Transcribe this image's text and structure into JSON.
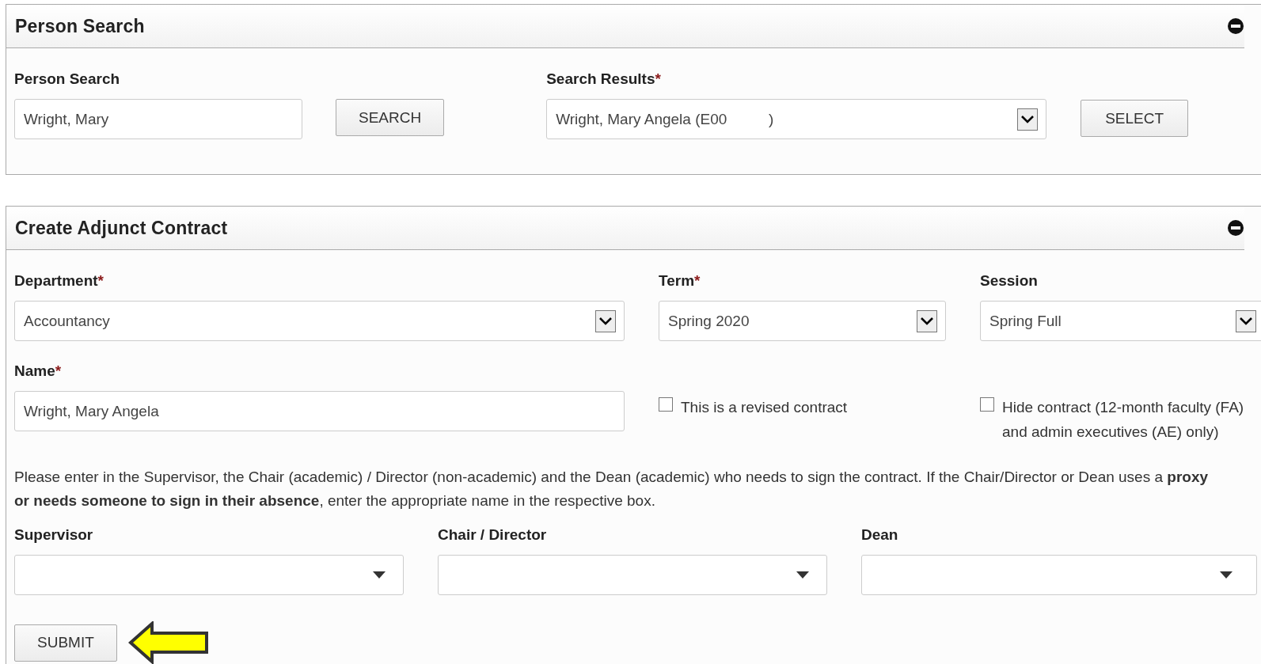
{
  "person_search": {
    "title": "Person Search",
    "expanded": true,
    "search_field": {
      "label": "Person Search",
      "value": "Wright, Mary"
    },
    "search_button": "SEARCH",
    "results": {
      "label": "Search Results",
      "required_mark": "*",
      "value": "Wright, Mary Angela (E00          )"
    },
    "select_button": "SELECT"
  },
  "create_contract": {
    "title": "Create Adjunct Contract",
    "expanded": true,
    "department": {
      "label": "Department",
      "required_mark": "*",
      "value": "Accountancy"
    },
    "term": {
      "label": "Term",
      "required_mark": "*",
      "value": "Spring 2020"
    },
    "session": {
      "label": "Session",
      "value": "Spring Full"
    },
    "name": {
      "label": "Name",
      "required_mark": "*",
      "value": "Wright, Mary Angela"
    },
    "checkboxes": [
      {
        "label": "This is a revised contract",
        "checked": false
      },
      {
        "label": "Hide contract (12-month faculty (FA) and admin executives (AE) only)",
        "checked": false
      }
    ],
    "instructions": "Please enter in the Supervisor, the Chair (academic) / Director (non-academic) and the Dean (academic) who needs to sign the contract. If the Chair/Director or Dean uses a **proxy or needs someone to sign in their absence**, enter the appropriate name in the respective box.",
    "signers": [
      {
        "label": "Supervisor"
      },
      {
        "label": "Chair / Director"
      },
      {
        "label": "Dean"
      }
    ],
    "submit_button": "SUBMIT"
  }
}
